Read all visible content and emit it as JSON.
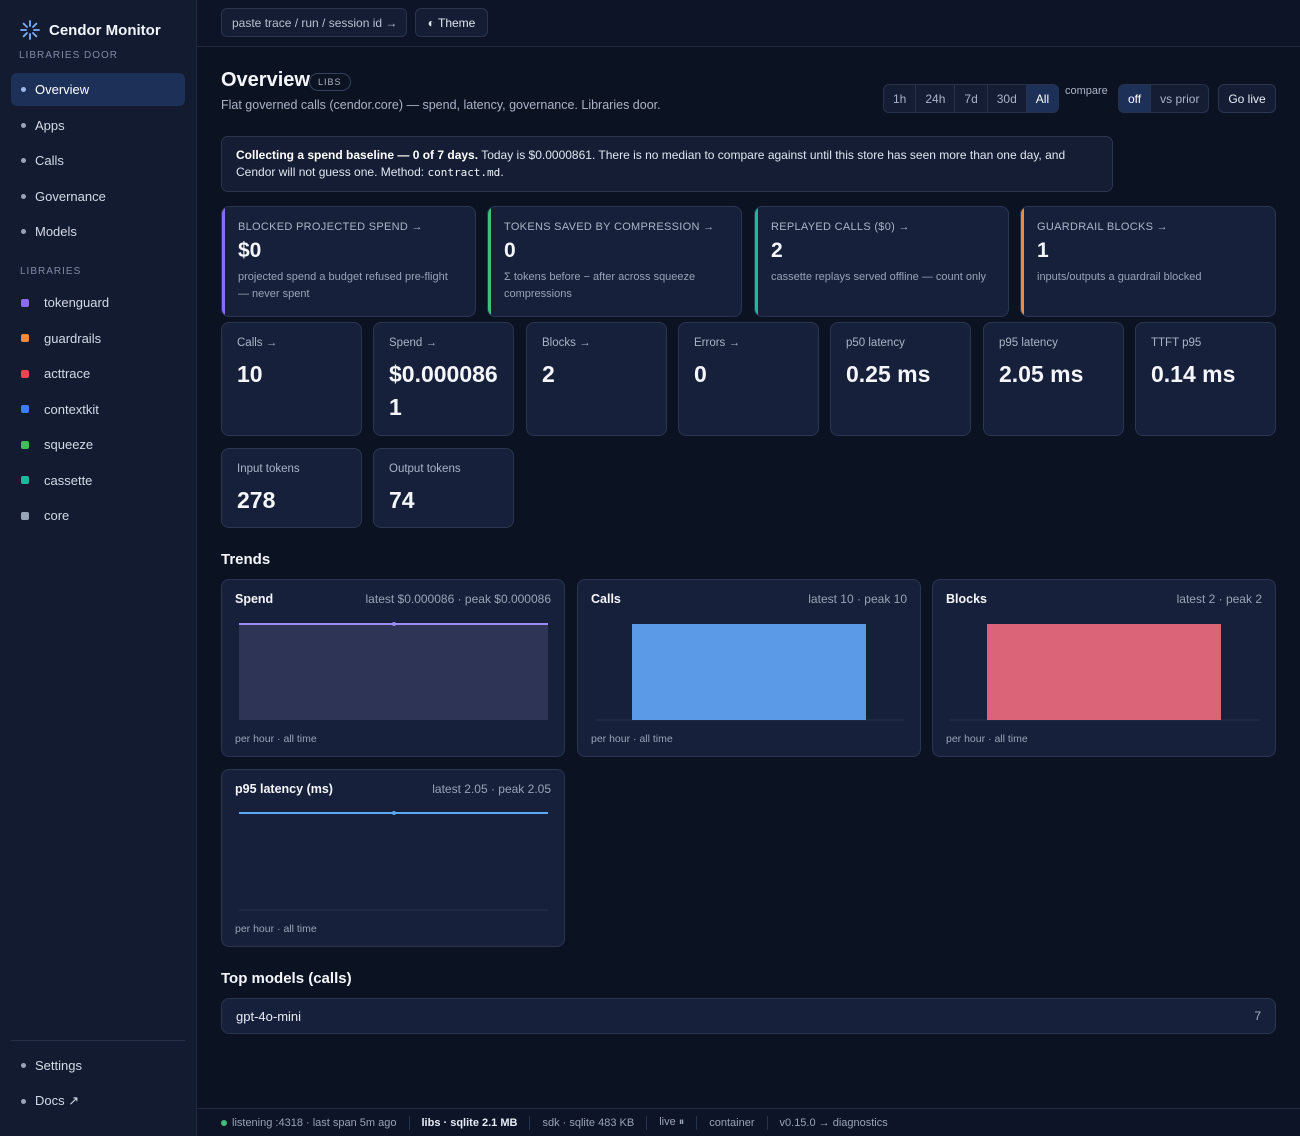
{
  "brand": {
    "title": "Cendor Monitor",
    "subtitle": "LIBRARIES DOOR"
  },
  "nav": [
    {
      "label": "Overview",
      "active": true
    },
    {
      "label": "Apps"
    },
    {
      "label": "Calls"
    },
    {
      "label": "Governance"
    },
    {
      "label": "Models"
    }
  ],
  "libraries_label": "LIBRARIES",
  "libraries": [
    {
      "label": "tokenguard",
      "color": "#8b6cf0"
    },
    {
      "label": "guardrails",
      "color": "#f08a3c"
    },
    {
      "label": "acttrace",
      "color": "#ec4452"
    },
    {
      "label": "contextkit",
      "color": "#3c7ef0"
    },
    {
      "label": "squeeze",
      "color": "#3fbf5a"
    },
    {
      "label": "cassette",
      "color": "#1fb89a"
    },
    {
      "label": "core",
      "color": "#9aa4b8"
    }
  ],
  "footer_nav": {
    "settings": "Settings",
    "docs": "Docs ↗"
  },
  "topbar": {
    "trace_placeholder": "paste trace / run / session id →",
    "theme_label": "◐ Theme"
  },
  "header": {
    "title": "Overview",
    "badge": "LIBS",
    "subtitle": "Flat governed calls (cendor.core) — spend, latency, governance. Libraries door.",
    "ranges": [
      "1h",
      "24h",
      "7d",
      "30d",
      "All"
    ],
    "range_selected": "All",
    "compare_label": "compare",
    "compare_options": [
      "off",
      "vs prior"
    ],
    "compare_selected": "off",
    "golive_label": "Go live"
  },
  "notice": {
    "bold": "Collecting a spend baseline — 0 of 7 days.",
    "text": " Today is $0.0000861. There is no median to compare against until this store has seen more than one day, and Cendor will not guess one. Method: ",
    "code": "contract.md",
    "end": "."
  },
  "kpis": [
    {
      "label": "BLOCKED PROJECTED SPEND →",
      "value": "$0",
      "desc": "projected spend a budget refused pre-flight — never spent",
      "accent": "#8b6cf0"
    },
    {
      "label": "TOKENS SAVED BY COMPRESSION →",
      "value": "0",
      "desc": "Σ tokens before − after across squeeze compressions",
      "accent": "#3fbf7a"
    },
    {
      "label": "REPLAYED CALLS ($0) →",
      "value": "2",
      "desc": "cassette replays served offline — count only",
      "accent": "#1fb89a"
    },
    {
      "label": "GUARDRAIL BLOCKS →",
      "value": "1",
      "desc": "inputs/outputs a guardrail blocked",
      "accent": "#f08a3c"
    }
  ],
  "stats": [
    {
      "label": "Calls →",
      "value": "10"
    },
    {
      "label": "Spend →",
      "value": "$0.0000861"
    },
    {
      "label": "Blocks →",
      "value": "2"
    },
    {
      "label": "Errors →",
      "value": "0"
    },
    {
      "label": "p50 latency",
      "value": "0.25 ms"
    },
    {
      "label": "p95 latency",
      "value": "2.05 ms"
    },
    {
      "label": "TTFT p95",
      "value": "0.14 ms"
    },
    {
      "label": "Input tokens",
      "value": "278"
    },
    {
      "label": "Output tokens",
      "value": "74"
    }
  ],
  "trends_title": "Trends",
  "trends": [
    {
      "title": "Spend",
      "meta": "latest $0.000086 · peak $0.000086",
      "foot": "per hour · all time",
      "kind": "area",
      "color": "#9b8cf5"
    },
    {
      "title": "Calls",
      "meta": "latest 10 · peak 10",
      "foot": "per hour · all time",
      "kind": "bar",
      "color": "#5b9ae6"
    },
    {
      "title": "Blocks",
      "meta": "latest 2 · peak 2",
      "foot": "per hour · all time",
      "kind": "bar",
      "color": "#dc6478"
    },
    {
      "title": "p95 latency (ms)",
      "meta": "latest 2.05 · peak 2.05",
      "foot": "per hour · all time",
      "kind": "line",
      "color": "#5aa8f0"
    }
  ],
  "top_models_title": "Top models (calls)",
  "top_models": [
    {
      "name": "gpt-4o-mini",
      "count": "7"
    }
  ],
  "statusbar": {
    "listening": "listening :4318 · last span 5m ago",
    "libs": "libs · sqlite 2.1 MB",
    "sdk": "sdk · sqlite 483 KB",
    "live": "live ⏸",
    "container": "container",
    "version": "v0.15.0 → diagnostics"
  }
}
